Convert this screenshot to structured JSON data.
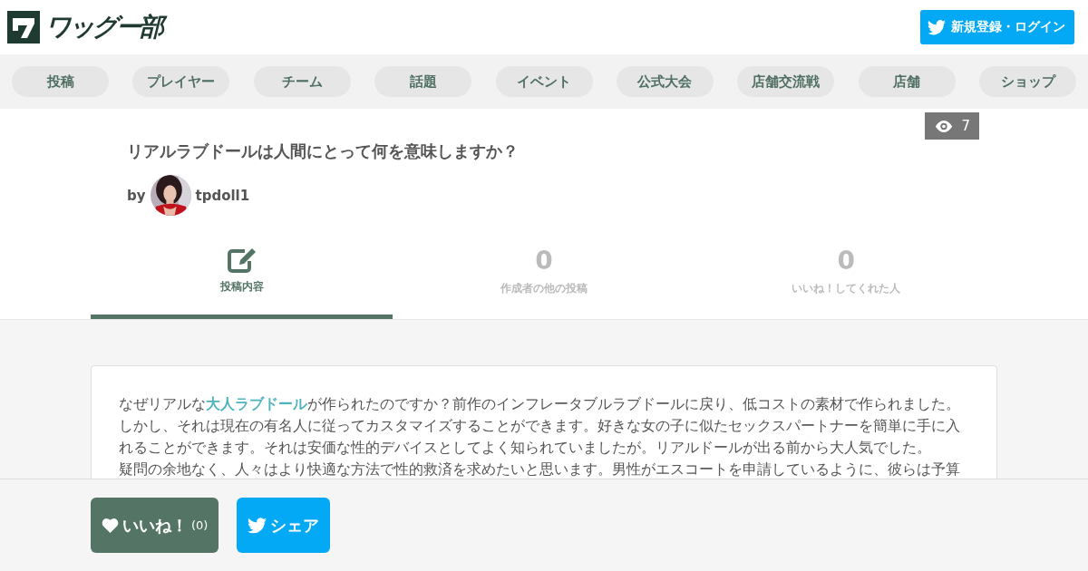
{
  "header": {
    "logo": "ワッグー部",
    "login_button": "新規登録・ログイン"
  },
  "nav": [
    {
      "label": "投稿"
    },
    {
      "label": "プレイヤー"
    },
    {
      "label": "チーム"
    },
    {
      "label": "話題"
    },
    {
      "label": "イベント"
    },
    {
      "label": "公式大会"
    },
    {
      "label": "店舗交流戦"
    },
    {
      "label": "店舗"
    },
    {
      "label": "ショップ"
    }
  ],
  "post": {
    "views": "7",
    "title": "リアルラブドールは人間にとって何を意味しますか？",
    "by": "by",
    "author": "tpdoll1"
  },
  "tabs": [
    {
      "kind": "icon",
      "label": "投稿内容",
      "selected": true
    },
    {
      "kind": "count",
      "count": "0",
      "label": "作成者の他の投稿",
      "selected": false
    },
    {
      "kind": "count",
      "count": "0",
      "label": "いいね！してくれた人",
      "selected": false
    }
  ],
  "body": {
    "paragraphs": [
      {
        "before": "なぜリアルな",
        "link": "大人ラブドール",
        "after": "が作られたのですか？前作のインフレータブルラブドールに戻り、低コストの素材で作られました。しかし、それは現在の有名人に従ってカスタマイズすることができます。好きな女の子に似たセックスパートナーを簡単に手に入れることができます。それは安価な性的デバイスとしてよく知られていましたが。リアルドールが出る前から大人気でした。"
      },
      {
        "before": "疑問の余地なく、人々はより快適な方法で性的救済を求めたいと思います。男性がエスコートを申請しているように、彼らは予算"
      }
    ]
  },
  "footer": {
    "like_button": "いいね！",
    "like_count": "(0)",
    "share_button": "シェア"
  }
}
